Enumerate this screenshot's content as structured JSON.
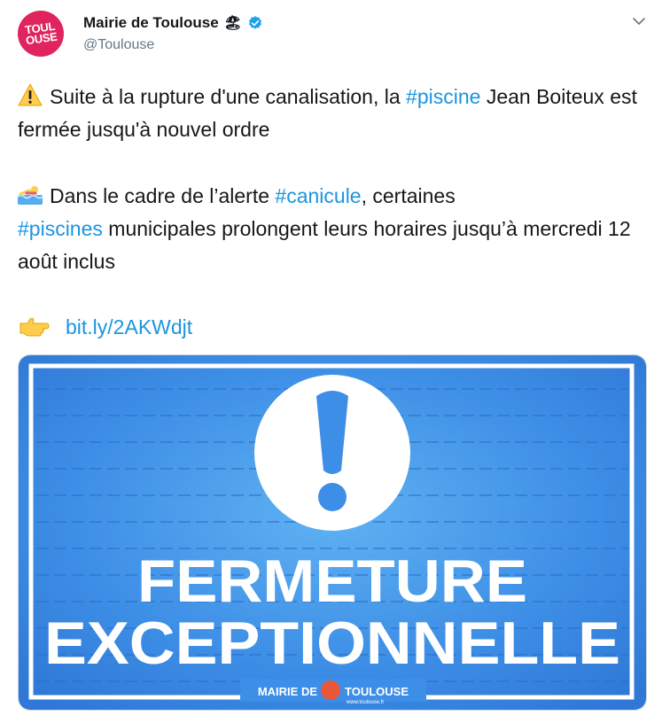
{
  "tweet": {
    "author": {
      "display_name": "Mairie de Toulouse",
      "name_emoji": "🏖",
      "handle": "@Toulouse",
      "avatar_text_1": "TOUL",
      "avatar_text_2": "OUSE"
    },
    "paragraph1": {
      "part1": "Suite à la rupture d'une canalisation, la ",
      "hashtag": "#piscine",
      "part2": " Jean Boiteux est fermée jusqu'à nouvel ordre"
    },
    "paragraph2": {
      "part1": "Dans le cadre de l’alerte ",
      "hashtag1": "#canicule",
      "part2": ", certaines ",
      "hashtag2": "#piscines",
      "part3": " municipales prolongent leurs horaires jusqu’à mercredi 12 août inclus"
    },
    "link": "bit.ly/2AKWdjt",
    "image": {
      "line1": "FERMETURE",
      "line2": "EXCEPTIONNELLE",
      "footer_left": "MAIRIE DE",
      "footer_right": "TOULOUSE",
      "footer_url": "www.toulouse.fr"
    }
  },
  "colors": {
    "hashtag": "#1b95e0",
    "avatar": "#e0245e",
    "image_bg": "#3d8ee6"
  },
  "icons": {
    "warning": "warning-icon",
    "swimmer": "swimmer-icon",
    "pointing": "pointing-hand-icon",
    "verified": "verified-badge-icon",
    "caret": "chevron-down-icon"
  }
}
